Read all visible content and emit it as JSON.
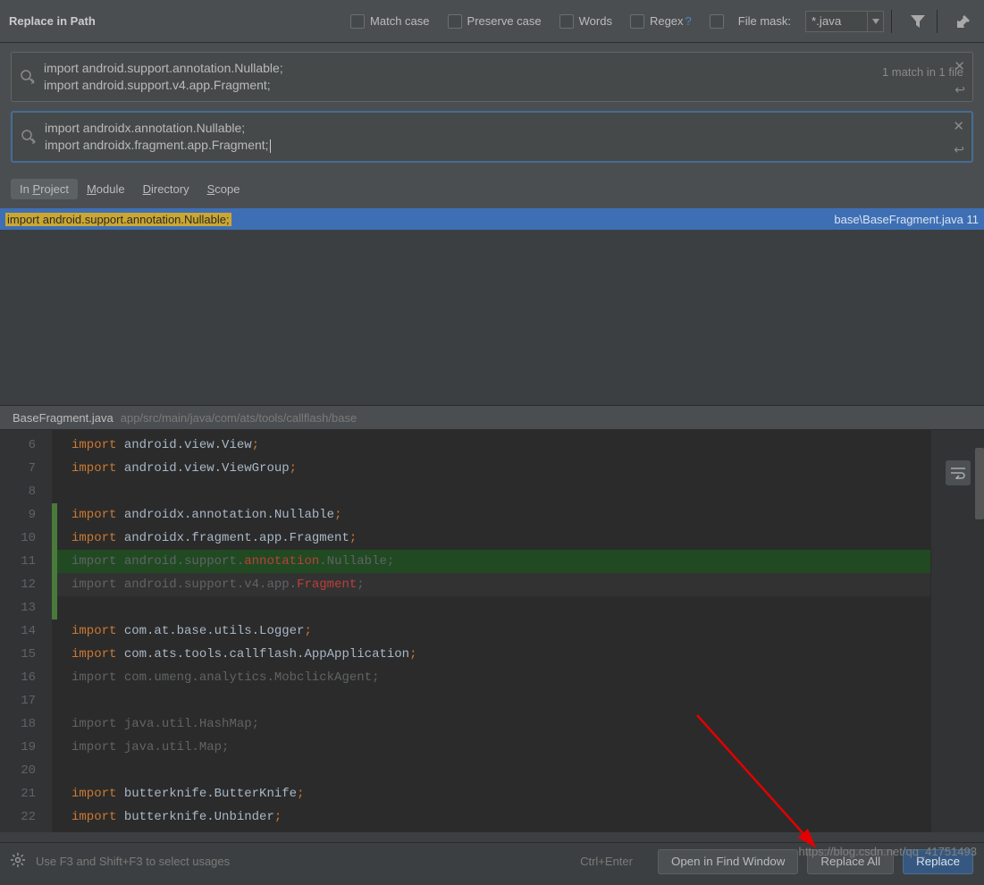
{
  "title": "Replace in Path",
  "options": {
    "match_case": "Match case",
    "preserve_case": "Preserve case",
    "words": "Words",
    "regex": "Regex",
    "file_mask_label": "File mask:",
    "file_mask_value": "*.java"
  },
  "search_text": "import android.support.annotation.Nullable;\nimport android.support.v4.app.Fragment;",
  "replace_text": "import androidx.annotation.Nullable;\nimport androidx.fragment.app.Fragment;",
  "match_summary": "1 match in 1 file",
  "scopes": {
    "in_project": "In Project",
    "module": "Module",
    "directory": "Directory",
    "scope": "Scope"
  },
  "result": {
    "match_text": "import android.support.annotation.Nullable;",
    "path": "base\\BaseFragment.java 11"
  },
  "preview": {
    "filename": "BaseFragment.java",
    "path": "app/src/main/java/com/ats/tools/callflash/base"
  },
  "code": {
    "lines": [
      {
        "num": 6,
        "kw": "import",
        "rest": " android.view.View",
        "semi": ";",
        "cb": "",
        "hl": ""
      },
      {
        "num": 7,
        "kw": "import",
        "rest": " android.view.ViewGroup",
        "semi": ";",
        "cb": "",
        "hl": ""
      },
      {
        "num": 8,
        "kw": "",
        "rest": "",
        "semi": "",
        "cb": "",
        "hl": ""
      },
      {
        "num": 9,
        "kw": "import",
        "rest": " androidx.annotation.",
        "cls": "Nullable",
        "semi": ";",
        "cb": "green",
        "hl": ""
      },
      {
        "num": 10,
        "kw": "import",
        "rest": " androidx.fragment.app.Fragment",
        "semi": ";",
        "cb": "green",
        "hl": ""
      },
      {
        "num": 11,
        "kw_gray": "import",
        "rest_gray": " android.support.",
        "err": "annotation",
        "rest2_gray": ".Nullable",
        "semi_gray": ";",
        "cb": "green",
        "hl": "green"
      },
      {
        "num": 12,
        "kw_gray": "import",
        "rest_gray": " android.support.v4.app.",
        "err": "Fragment",
        "semi_gray": ";",
        "cb": "green",
        "hl": "dark"
      },
      {
        "num": 13,
        "kw": "",
        "rest": "",
        "semi": "",
        "cb": "green",
        "hl": ""
      },
      {
        "num": 14,
        "kw": "import",
        "rest": " com.at.base.utils.Logger",
        "semi": ";",
        "cb": "",
        "hl": ""
      },
      {
        "num": 15,
        "kw": "import",
        "rest": " com.ats.tools.callflash.AppApplication",
        "semi": ";",
        "cb": "",
        "hl": ""
      },
      {
        "num": 16,
        "kw_gray": "import",
        "rest_gray": " com.umeng.analytics.MobclickAgent;",
        "cb": "",
        "hl": ""
      },
      {
        "num": 17,
        "kw": "",
        "rest": "",
        "semi": "",
        "cb": "",
        "hl": ""
      },
      {
        "num": 18,
        "kw_gray": "import",
        "rest_gray": " java.util.HashMap;",
        "cb": "",
        "hl": ""
      },
      {
        "num": 19,
        "kw_gray": "import",
        "rest_gray": " java.util.Map;",
        "cb": "",
        "hl": ""
      },
      {
        "num": 20,
        "kw": "",
        "rest": "",
        "semi": "",
        "cb": "",
        "hl": ""
      },
      {
        "num": 21,
        "kw": "import",
        "rest": " butterknife.ButterKnife",
        "semi": ";",
        "cb": "",
        "hl": ""
      },
      {
        "num": 22,
        "kw": "import",
        "rest": " butterknife.Unbinder",
        "semi": ";",
        "cb": "",
        "hl": ""
      }
    ]
  },
  "footer": {
    "hint": "Use F3 and Shift+F3 to select usages",
    "shortcut": "Ctrl+Enter",
    "open_window": "Open in Find Window",
    "replace_all": "Replace All",
    "replace": "Replace"
  },
  "watermark": "https://blog.csdn.net/qq_41751493"
}
